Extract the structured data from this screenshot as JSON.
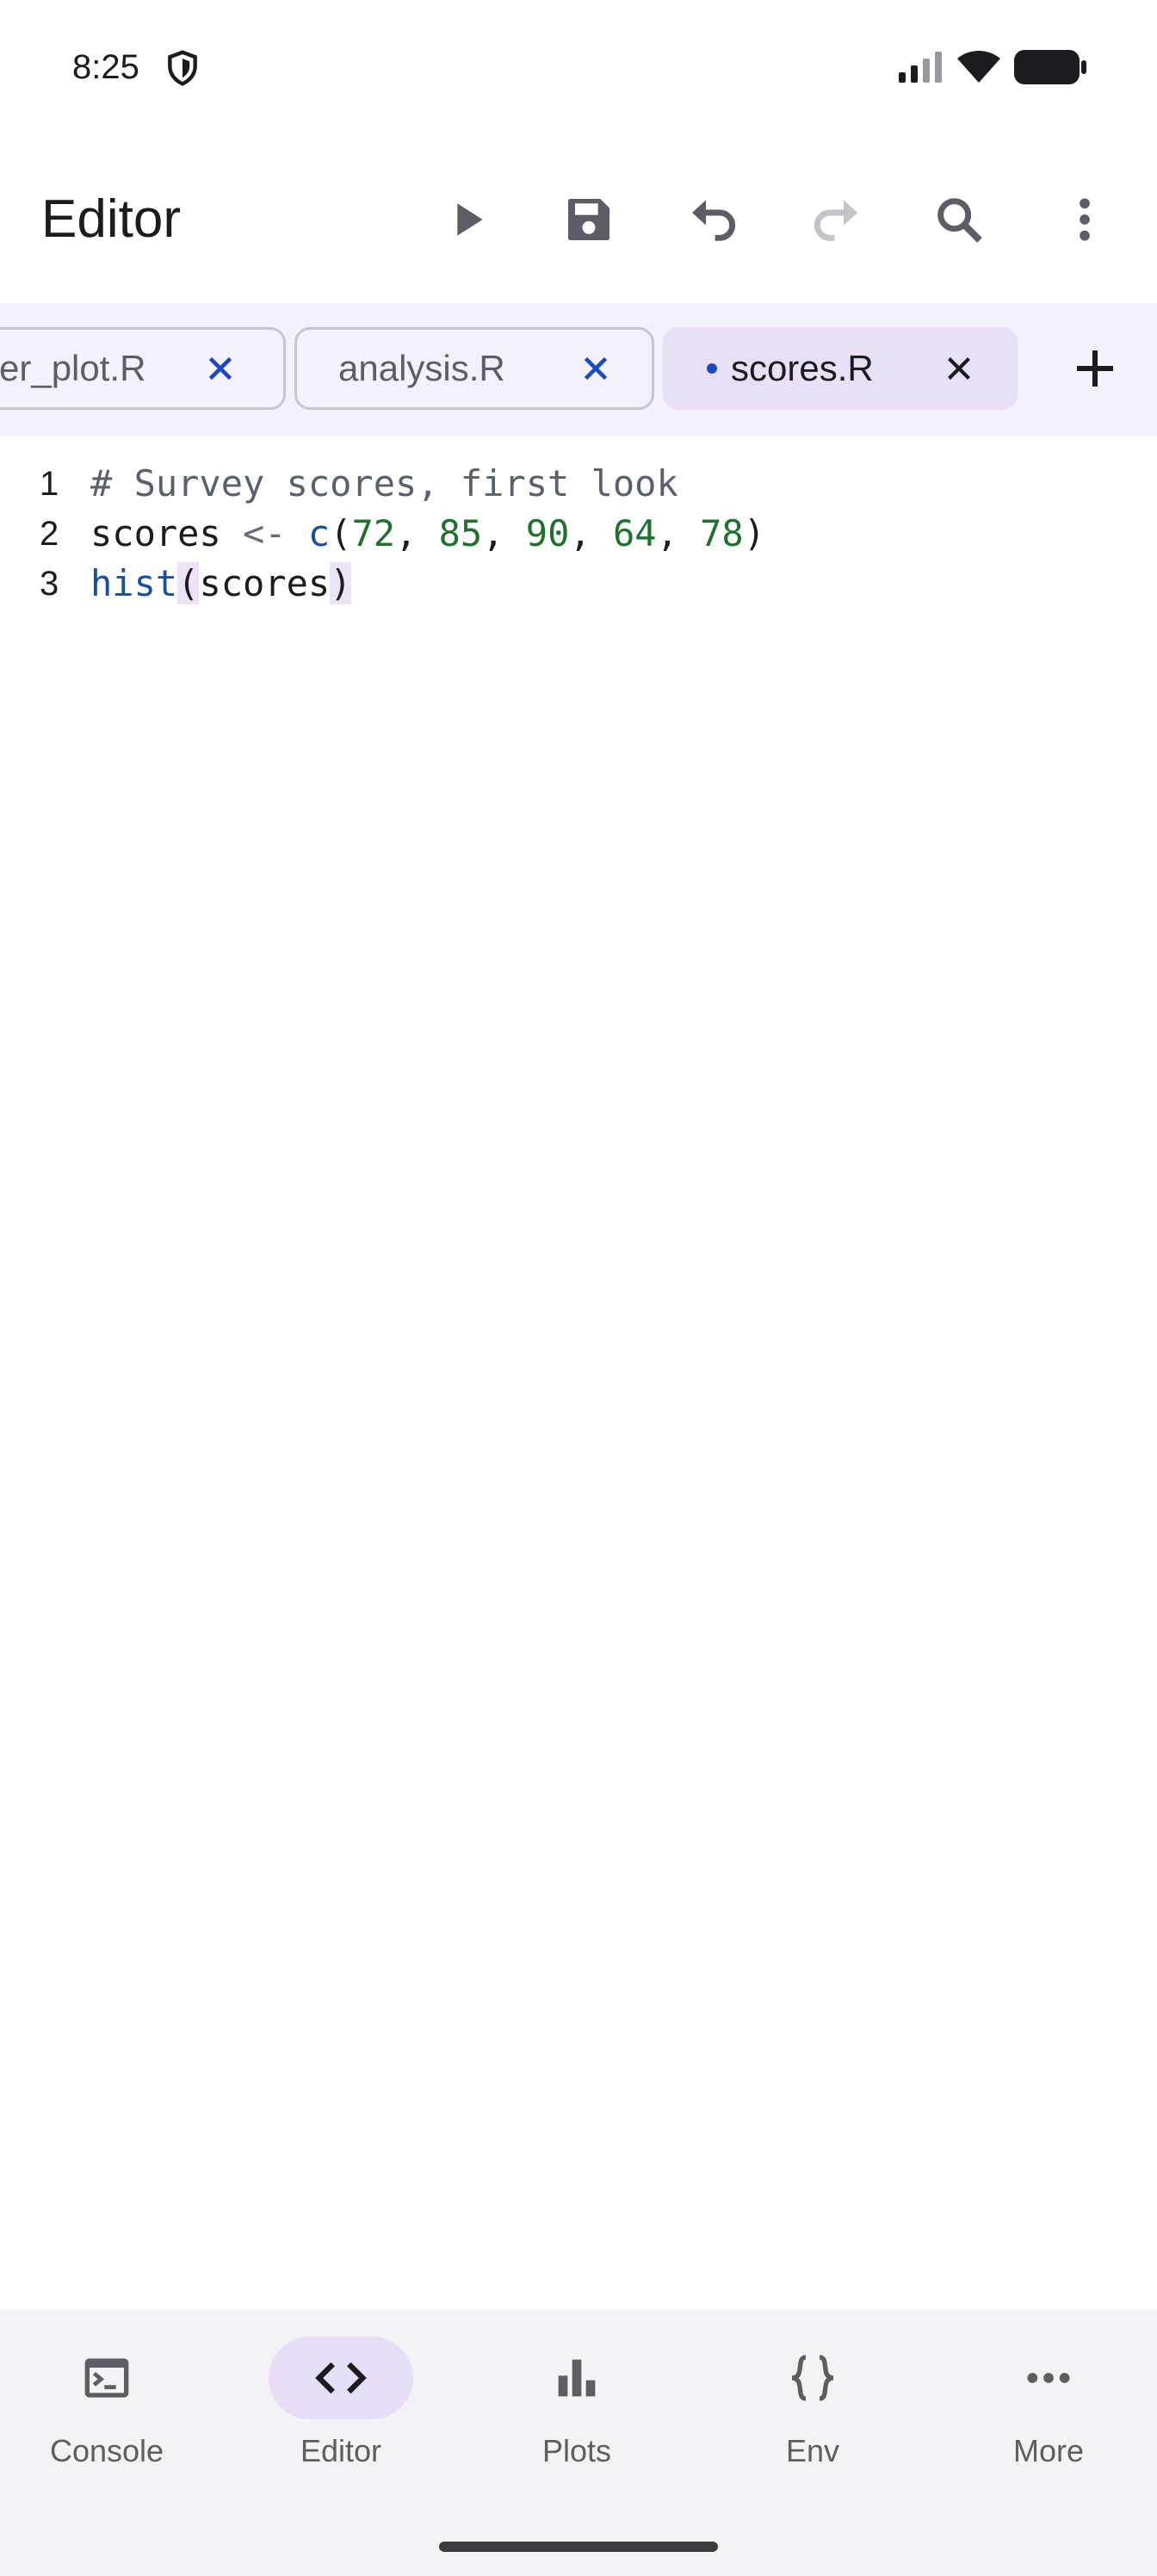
{
  "status_bar": {
    "time": "8:25",
    "icons": [
      "shield-icon",
      "signal-icon",
      "wifi-icon",
      "battery-icon"
    ]
  },
  "app_bar": {
    "title": "Editor",
    "actions": [
      "run-icon",
      "save-icon",
      "undo-icon",
      "redo-icon",
      "search-icon",
      "more-vert-icon"
    ],
    "redo_enabled": false
  },
  "tabs": [
    {
      "label": "er_plot.R",
      "active": false,
      "modified": false
    },
    {
      "label": "analysis.R",
      "active": false,
      "modified": false
    },
    {
      "label": "scores.R",
      "active": true,
      "modified": true
    }
  ],
  "editor": {
    "lines": [
      {
        "number": "1",
        "tokens": [
          {
            "t": "# Survey scores, first look",
            "k": "comment"
          }
        ]
      },
      {
        "number": "2",
        "tokens": [
          {
            "t": "scores",
            "k": "ident"
          },
          {
            "t": " ",
            "k": "ident"
          },
          {
            "t": "<-",
            "k": "op"
          },
          {
            "t": " ",
            "k": "ident"
          },
          {
            "t": "c",
            "k": "fn"
          },
          {
            "t": "(",
            "k": "punc"
          },
          {
            "t": "72",
            "k": "num"
          },
          {
            "t": ", ",
            "k": "punc"
          },
          {
            "t": "85",
            "k": "num"
          },
          {
            "t": ", ",
            "k": "punc"
          },
          {
            "t": "90",
            "k": "num"
          },
          {
            "t": ", ",
            "k": "punc"
          },
          {
            "t": "64",
            "k": "num"
          },
          {
            "t": ", ",
            "k": "punc"
          },
          {
            "t": "78",
            "k": "num"
          },
          {
            "t": ")",
            "k": "punc"
          }
        ]
      },
      {
        "number": "3",
        "tokens": [
          {
            "t": "hist",
            "k": "fn"
          },
          {
            "t": "(",
            "k": "punc",
            "hl": true
          },
          {
            "t": "scores",
            "k": "ident"
          },
          {
            "t": ")",
            "k": "punc",
            "hl": true
          }
        ]
      }
    ]
  },
  "bottom_nav": [
    {
      "label": "Console",
      "icon": "console-icon",
      "active": false
    },
    {
      "label": "Editor",
      "icon": "code-icon",
      "active": true
    },
    {
      "label": "Plots",
      "icon": "bar-chart-icon",
      "active": false
    },
    {
      "label": "Env",
      "icon": "braces-icon",
      "active": false
    },
    {
      "label": "More",
      "icon": "more-horiz-icon",
      "active": false
    }
  ],
  "colors": {
    "accent": "#1a49c2",
    "tab_active_bg": "#e9e0f7",
    "tab_strip_bg": "#f3f2fa",
    "nav_bg": "#f3f2f7",
    "nav_active_pill": "#e9def8",
    "comment": "#5b616b",
    "function": "#1a4fa0",
    "number": "#1f6f2f"
  }
}
